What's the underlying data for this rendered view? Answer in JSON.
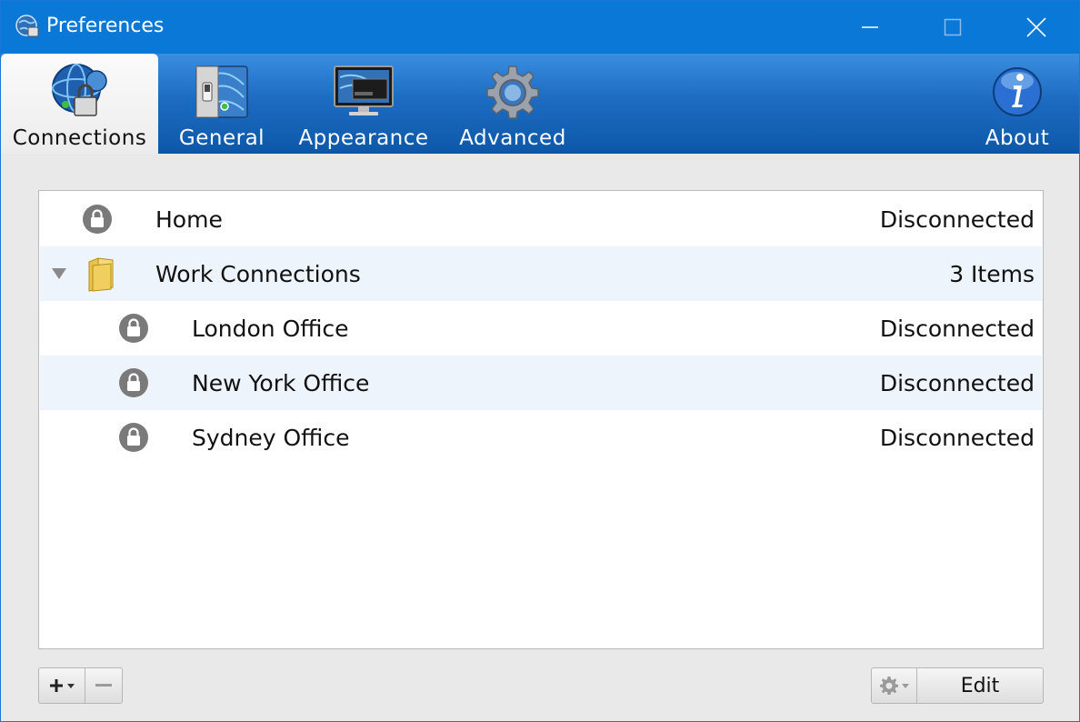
{
  "window": {
    "title": "Preferences"
  },
  "toolbar": {
    "tabs": [
      {
        "label": "Connections",
        "selected": true
      },
      {
        "label": "General"
      },
      {
        "label": "Appearance"
      },
      {
        "label": "Advanced"
      },
      {
        "label": "About"
      }
    ]
  },
  "connections": {
    "rows": [
      {
        "label": "Home",
        "status": "Disconnected",
        "icon": "lock-icon"
      },
      {
        "label": "Work Connections",
        "status": "3 Items",
        "icon": "folder-icon",
        "expanded": true
      },
      {
        "label": "London Office",
        "status": "Disconnected",
        "icon": "lock-icon"
      },
      {
        "label": "New York Office",
        "status": "Disconnected",
        "icon": "lock-icon"
      },
      {
        "label": "Sydney Office",
        "status": "Disconnected",
        "icon": "lock-icon"
      }
    ]
  },
  "buttons": {
    "edit_label": "Edit"
  },
  "colors": {
    "titlebar": "#0a78d7",
    "toolbar_top": "#3a8ee0",
    "toolbar_bottom": "#0d57a8",
    "alt_row": "#eef4fc"
  }
}
